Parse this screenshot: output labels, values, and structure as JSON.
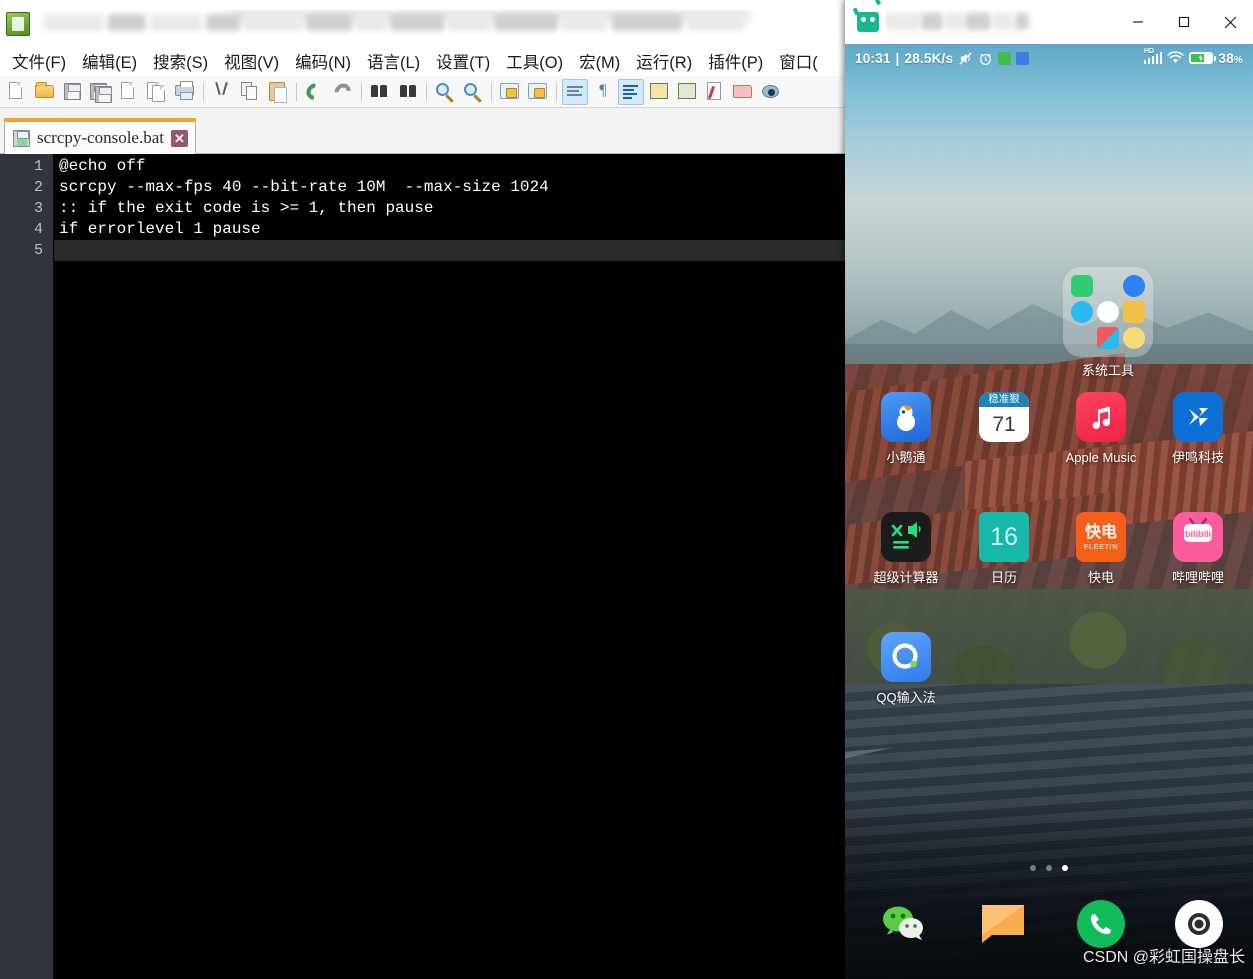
{
  "notepad": {
    "window_title": "",
    "app_icon": "notepadpp-icon",
    "menus": [
      {
        "label": "文件(F)",
        "mnemonic": "F"
      },
      {
        "label": "编辑(E)",
        "mnemonic": "E"
      },
      {
        "label": "搜索(S)",
        "mnemonic": "S"
      },
      {
        "label": "视图(V)",
        "mnemonic": "V"
      },
      {
        "label": "编码(N)",
        "mnemonic": "N"
      },
      {
        "label": "语言(L)",
        "mnemonic": "L"
      },
      {
        "label": "设置(T)",
        "mnemonic": "T"
      },
      {
        "label": "工具(O)",
        "mnemonic": "O"
      },
      {
        "label": "宏(M)",
        "mnemonic": "M"
      },
      {
        "label": "运行(R)",
        "mnemonic": "R"
      },
      {
        "label": "插件(P)",
        "mnemonic": "P"
      },
      {
        "label": "窗口(",
        "mnemonic": ""
      }
    ],
    "toolbar": [
      "new-file-icon",
      "open-file-icon",
      "save-icon",
      "save-all-icon",
      "close-file-icon",
      "close-all-icon",
      "print-icon",
      "sep",
      "cut-icon",
      "copy-icon",
      "paste-icon",
      "sep",
      "undo-icon",
      "redo-icon",
      "sep",
      "find-icon",
      "replace-icon",
      "sep",
      "zoom-in-icon",
      "zoom-out-icon",
      "sep",
      "sync-vertical-icon",
      "sync-horizontal-icon",
      "sep",
      "word-wrap-icon",
      "show-all-chars-icon",
      "sep",
      "indent-guide-icon",
      "user-defined-language-icon",
      "document-map-icon",
      "function-list-icon",
      "folder-workspace-icon",
      "monitoring-icon"
    ],
    "tab": {
      "label": "scrcpy-console.bat",
      "close_label": "✕",
      "icon": "saved-file-icon",
      "active": true
    },
    "editor": {
      "line_numbers": [
        "1",
        "2",
        "3",
        "4",
        "5"
      ],
      "lines": [
        "@echo off",
        "scrcpy --max-fps 40 --bit-rate 10M  --max-size 1024",
        ":: if the exit code is >= 1, then pause",
        "if errorlevel 1 pause",
        ""
      ],
      "current_line": 5,
      "background": "#000000",
      "gutter_background": "#31353b",
      "text_color": "#ffffff"
    }
  },
  "scrcpy": {
    "window_title": "",
    "app_icon": "android-icon",
    "window_buttons": {
      "minimize": "—",
      "maximize": "▢",
      "close": "✕"
    },
    "status_bar": {
      "time": "10:31",
      "separator": "|",
      "network_speed": "28.5K/s",
      "icons_left": [
        "mute-icon",
        "alarm-icon",
        "green-badge-icon",
        "blue-badge-icon"
      ],
      "signal": "hd-signal-icon",
      "hd_label": "HD",
      "wifi": "wifi-icon",
      "battery_icon": "battery-charging-icon",
      "battery_level": "38",
      "battery_unit": "%"
    },
    "home": {
      "folder": {
        "label": "系统工具",
        "icons": [
          {
            "name": "security-shield-icon",
            "color": "#2fcc71"
          },
          {
            "name": "contacts-icon",
            "color": "#2f80f0"
          },
          {
            "name": "browser-icon",
            "color": "#2bbbf0"
          },
          {
            "name": "clock-icon",
            "color": "#ffffff"
          },
          {
            "name": "notes-icon",
            "color": "#f5c04a"
          },
          {
            "name": "gallery-icon",
            "color": "#4ec3a5"
          },
          {
            "name": "weather-icon",
            "color": "#f6d978"
          }
        ]
      },
      "apps": [
        {
          "label": "小鹅通",
          "icon": "xiaoetong-icon",
          "color": "#2f86f0"
        },
        {
          "label": "",
          "icon": "stock-widget-icon",
          "color": "#ffffff",
          "widget_header": "稳准狠",
          "widget_value": "71"
        },
        {
          "label": "Apple Music",
          "icon": "apple-music-icon",
          "color": "#fa3b54"
        },
        {
          "label": "伊鸣科技",
          "icon": "yiming-tech-icon",
          "color": "#0e6fd6"
        },
        {
          "label": "超级计算器",
          "icon": "super-calculator-icon",
          "color": "#1c1c1e"
        },
        {
          "label": "日历",
          "icon": "calendar-icon",
          "color": "#16b8ab",
          "day": "16"
        },
        {
          "label": "快电",
          "icon": "kuaidian-icon",
          "color": "#f4601a",
          "icon_text": "快电",
          "icon_subtext": "FLEETIN"
        },
        {
          "label": "哔哩哔哩",
          "icon": "bilibili-icon",
          "color": "#fb5c9b",
          "icon_text": "bilibili"
        },
        {
          "label": "QQ输入法",
          "icon": "qq-input-icon",
          "color": "#3d8ef5",
          "icon_text": "Q"
        }
      ],
      "page_dots": {
        "count": 3,
        "active_index": 2
      },
      "dock": [
        {
          "label": "",
          "icon": "wechat-icon",
          "color": "#4ec94e"
        },
        {
          "label": "",
          "icon": "messages-icon",
          "color": "#f9ad52"
        },
        {
          "label": "",
          "icon": "phone-icon",
          "color": "#12bb5a"
        },
        {
          "label": "",
          "icon": "camera-icon",
          "color": "#ffffff"
        }
      ]
    },
    "watermark": "CSDN @彩虹国操盘长"
  }
}
